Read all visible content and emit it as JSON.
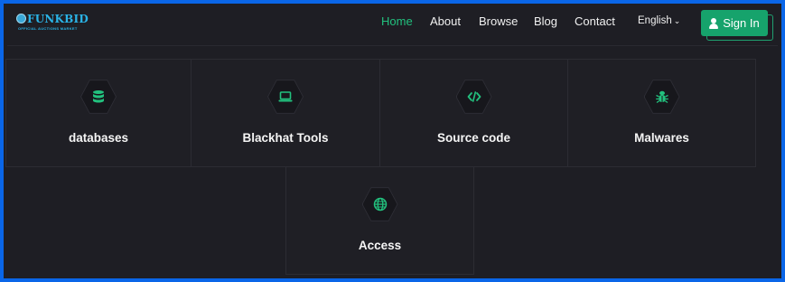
{
  "brand": {
    "name": "FUNKBID",
    "tagline": "OFFICIAL AUCTIONS MARKET"
  },
  "nav": {
    "items": [
      {
        "label": "Home",
        "active": true
      },
      {
        "label": "About",
        "active": false
      },
      {
        "label": "Browse",
        "active": false
      },
      {
        "label": "Blog",
        "active": false
      },
      {
        "label": "Contact",
        "active": false
      }
    ],
    "language": "English",
    "signin_label": "Sign In"
  },
  "categories": [
    {
      "label": "databases",
      "icon": "database-icon"
    },
    {
      "label": "Blackhat Tools",
      "icon": "laptop-icon"
    },
    {
      "label": "Source code",
      "icon": "code-icon"
    },
    {
      "label": "Malwares",
      "icon": "bug-icon"
    },
    {
      "label": "Access",
      "icon": "globe-icon"
    }
  ],
  "colors": {
    "accent": "#22c17e",
    "button": "#16a36c",
    "background": "#1e1e24",
    "frame_border": "#0a66e8",
    "brand": "#2ab3e6"
  }
}
